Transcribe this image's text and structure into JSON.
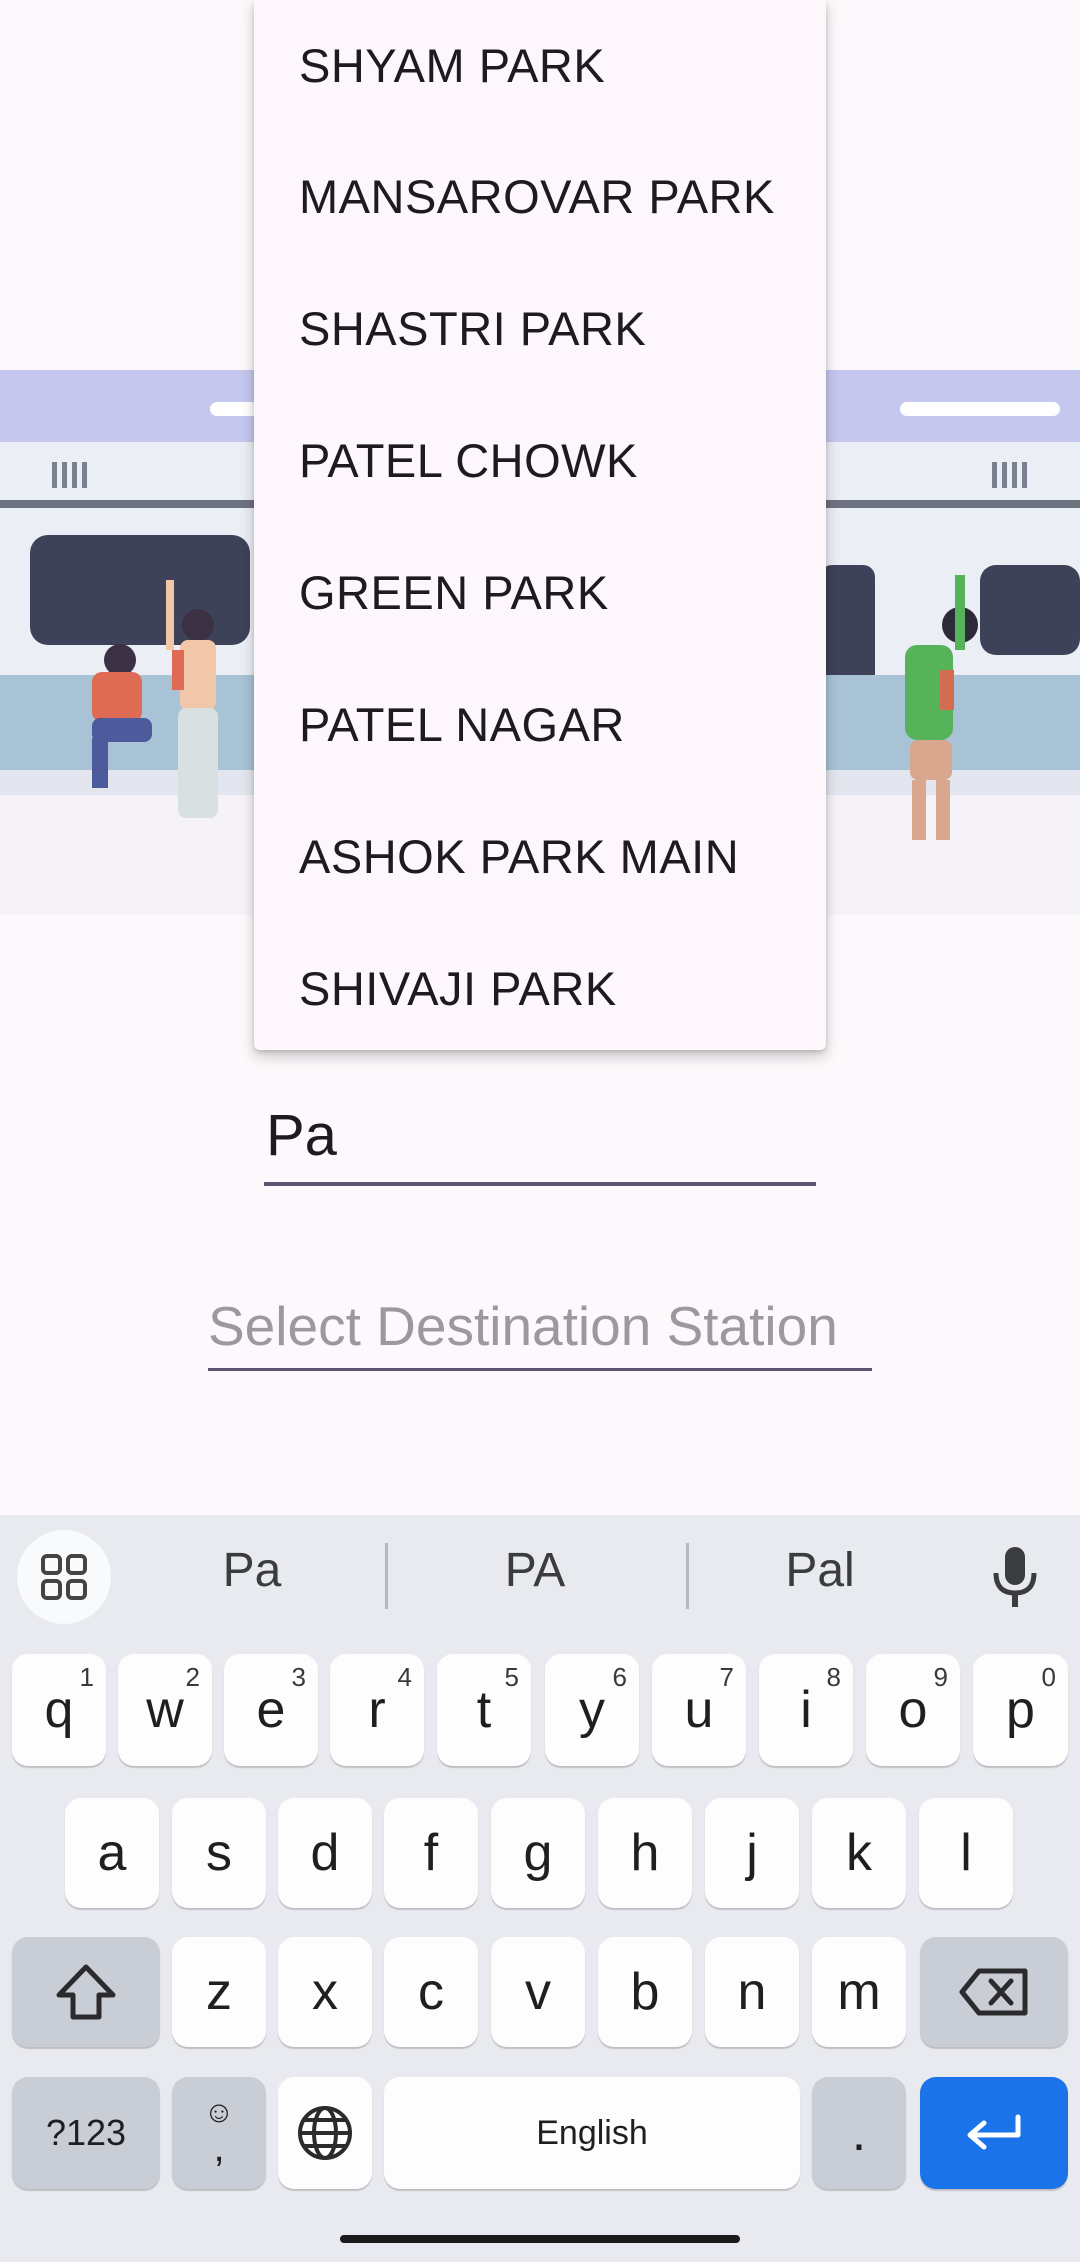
{
  "dropdown": {
    "items": [
      "SHYAM PARK",
      "MANSAROVAR PARK",
      "SHASTRI PARK",
      "PATEL CHOWK",
      "GREEN PARK",
      "PATEL NAGAR",
      "ASHOK PARK MAIN",
      "SHIVAJI PARK"
    ]
  },
  "source": {
    "value": "Pa"
  },
  "destination": {
    "placeholder": "Select Destination Station"
  },
  "keyboard": {
    "suggestions": [
      "Pa",
      "PA",
      "Pal"
    ],
    "row1": [
      [
        "q",
        "1"
      ],
      [
        "w",
        "2"
      ],
      [
        "e",
        "3"
      ],
      [
        "r",
        "4"
      ],
      [
        "t",
        "5"
      ],
      [
        "y",
        "6"
      ],
      [
        "u",
        "7"
      ],
      [
        "i",
        "8"
      ],
      [
        "o",
        "9"
      ],
      [
        "p",
        "0"
      ]
    ],
    "row2": [
      "a",
      "s",
      "d",
      "f",
      "g",
      "h",
      "j",
      "k",
      "l"
    ],
    "row3": [
      "z",
      "x",
      "c",
      "v",
      "b",
      "n",
      "m"
    ],
    "symbols_label": "?123",
    "comma_label": ",",
    "period_label": ".",
    "space_label": "English",
    "accent_color": "#1a73e8"
  }
}
